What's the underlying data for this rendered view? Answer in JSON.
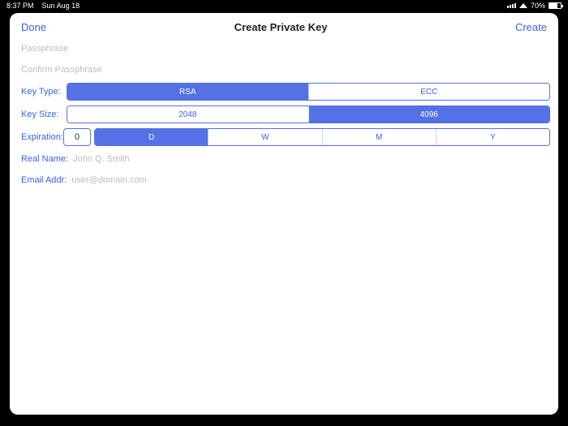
{
  "status": {
    "time": "8:37 PM",
    "date": "Sun Aug 18",
    "battery_pct": "70%"
  },
  "nav": {
    "done": "Done",
    "title": "Create Private Key",
    "create": "Create"
  },
  "fields": {
    "passphrase_placeholder": "Passphrase",
    "confirm_placeholder": "Confirm Passphrase",
    "key_type_label": "Key Type:",
    "key_size_label": "Key Size:",
    "expiration_label": "Expiration:",
    "expiration_value": "0",
    "real_name_label": "Real Name:",
    "real_name_placeholder": "John Q. Smith",
    "email_label": "Email Addr:",
    "email_placeholder": "user@domain.com"
  },
  "key_type": {
    "options": [
      "RSA",
      "ECC"
    ],
    "selected": 0
  },
  "key_size": {
    "options": [
      "2048",
      "4096"
    ],
    "selected": 1
  },
  "exp_unit": {
    "options": [
      "D",
      "W",
      "M",
      "Y"
    ],
    "selected": 0
  },
  "colors": {
    "accent": "#5571e6",
    "link": "#3b62f0"
  }
}
